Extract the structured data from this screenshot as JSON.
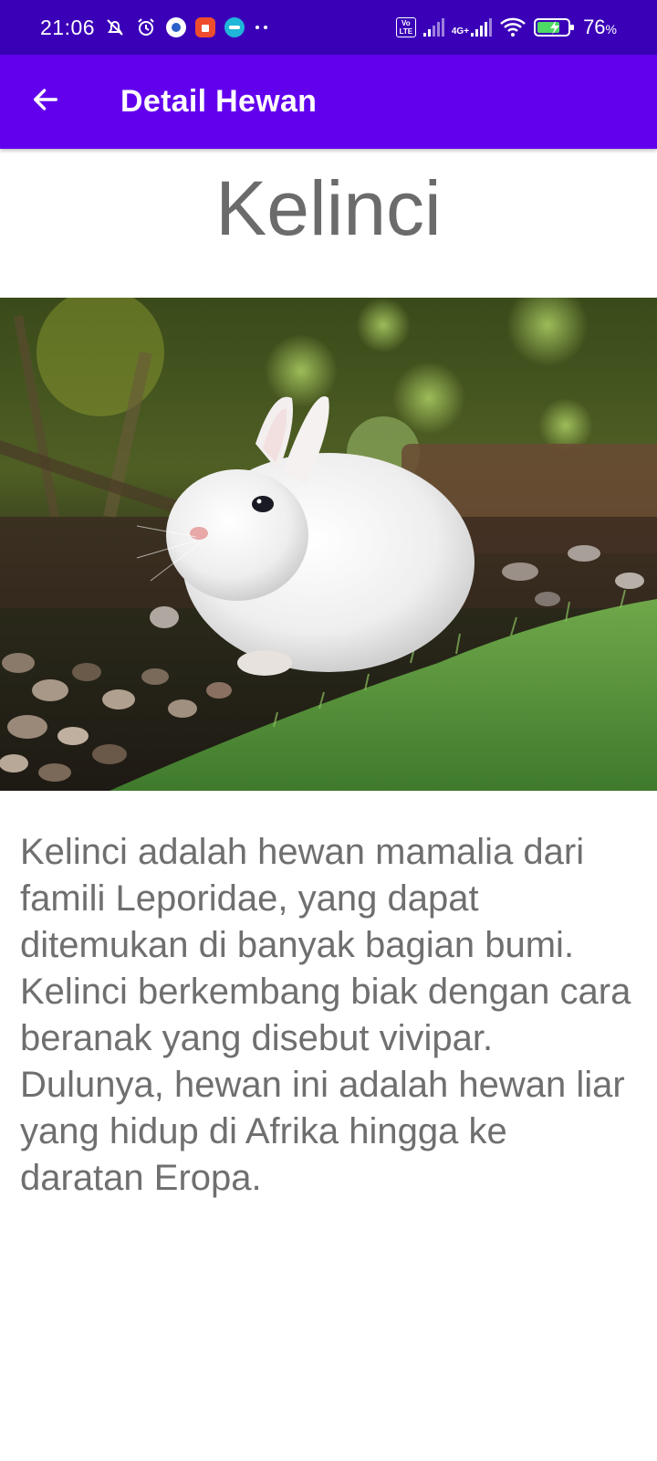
{
  "status_bar": {
    "time": "21:06",
    "network_label": "4G+",
    "volte_label": "Vo LTE",
    "battery_percent": "76",
    "battery_unit": "%",
    "icons": [
      "mute-bell-icon",
      "alarm-icon",
      "app-notification-icon",
      "shopee-icon",
      "canva-icon",
      "more-dots-icon",
      "volte-icon",
      "signal-icon",
      "signal-4g-icon",
      "wifi-icon",
      "battery-charging-icon"
    ]
  },
  "app_bar": {
    "title": "Detail Hewan",
    "back_icon": "arrow-back-icon",
    "background_color": "#6200ee",
    "status_color": "#3a00b8"
  },
  "animal": {
    "name": "Kelinci",
    "image_subject": "white rabbit",
    "description": "Kelinci adalah hewan mamalia dari famili Leporidae, yang dapat ditemukan di banyak bagian bumi. Kelinci berkembang biak dengan cara beranak yang disebut vivipar. Dulunya, hewan ini adalah hewan liar yang hidup di Afrika hingga ke daratan Eropa."
  }
}
